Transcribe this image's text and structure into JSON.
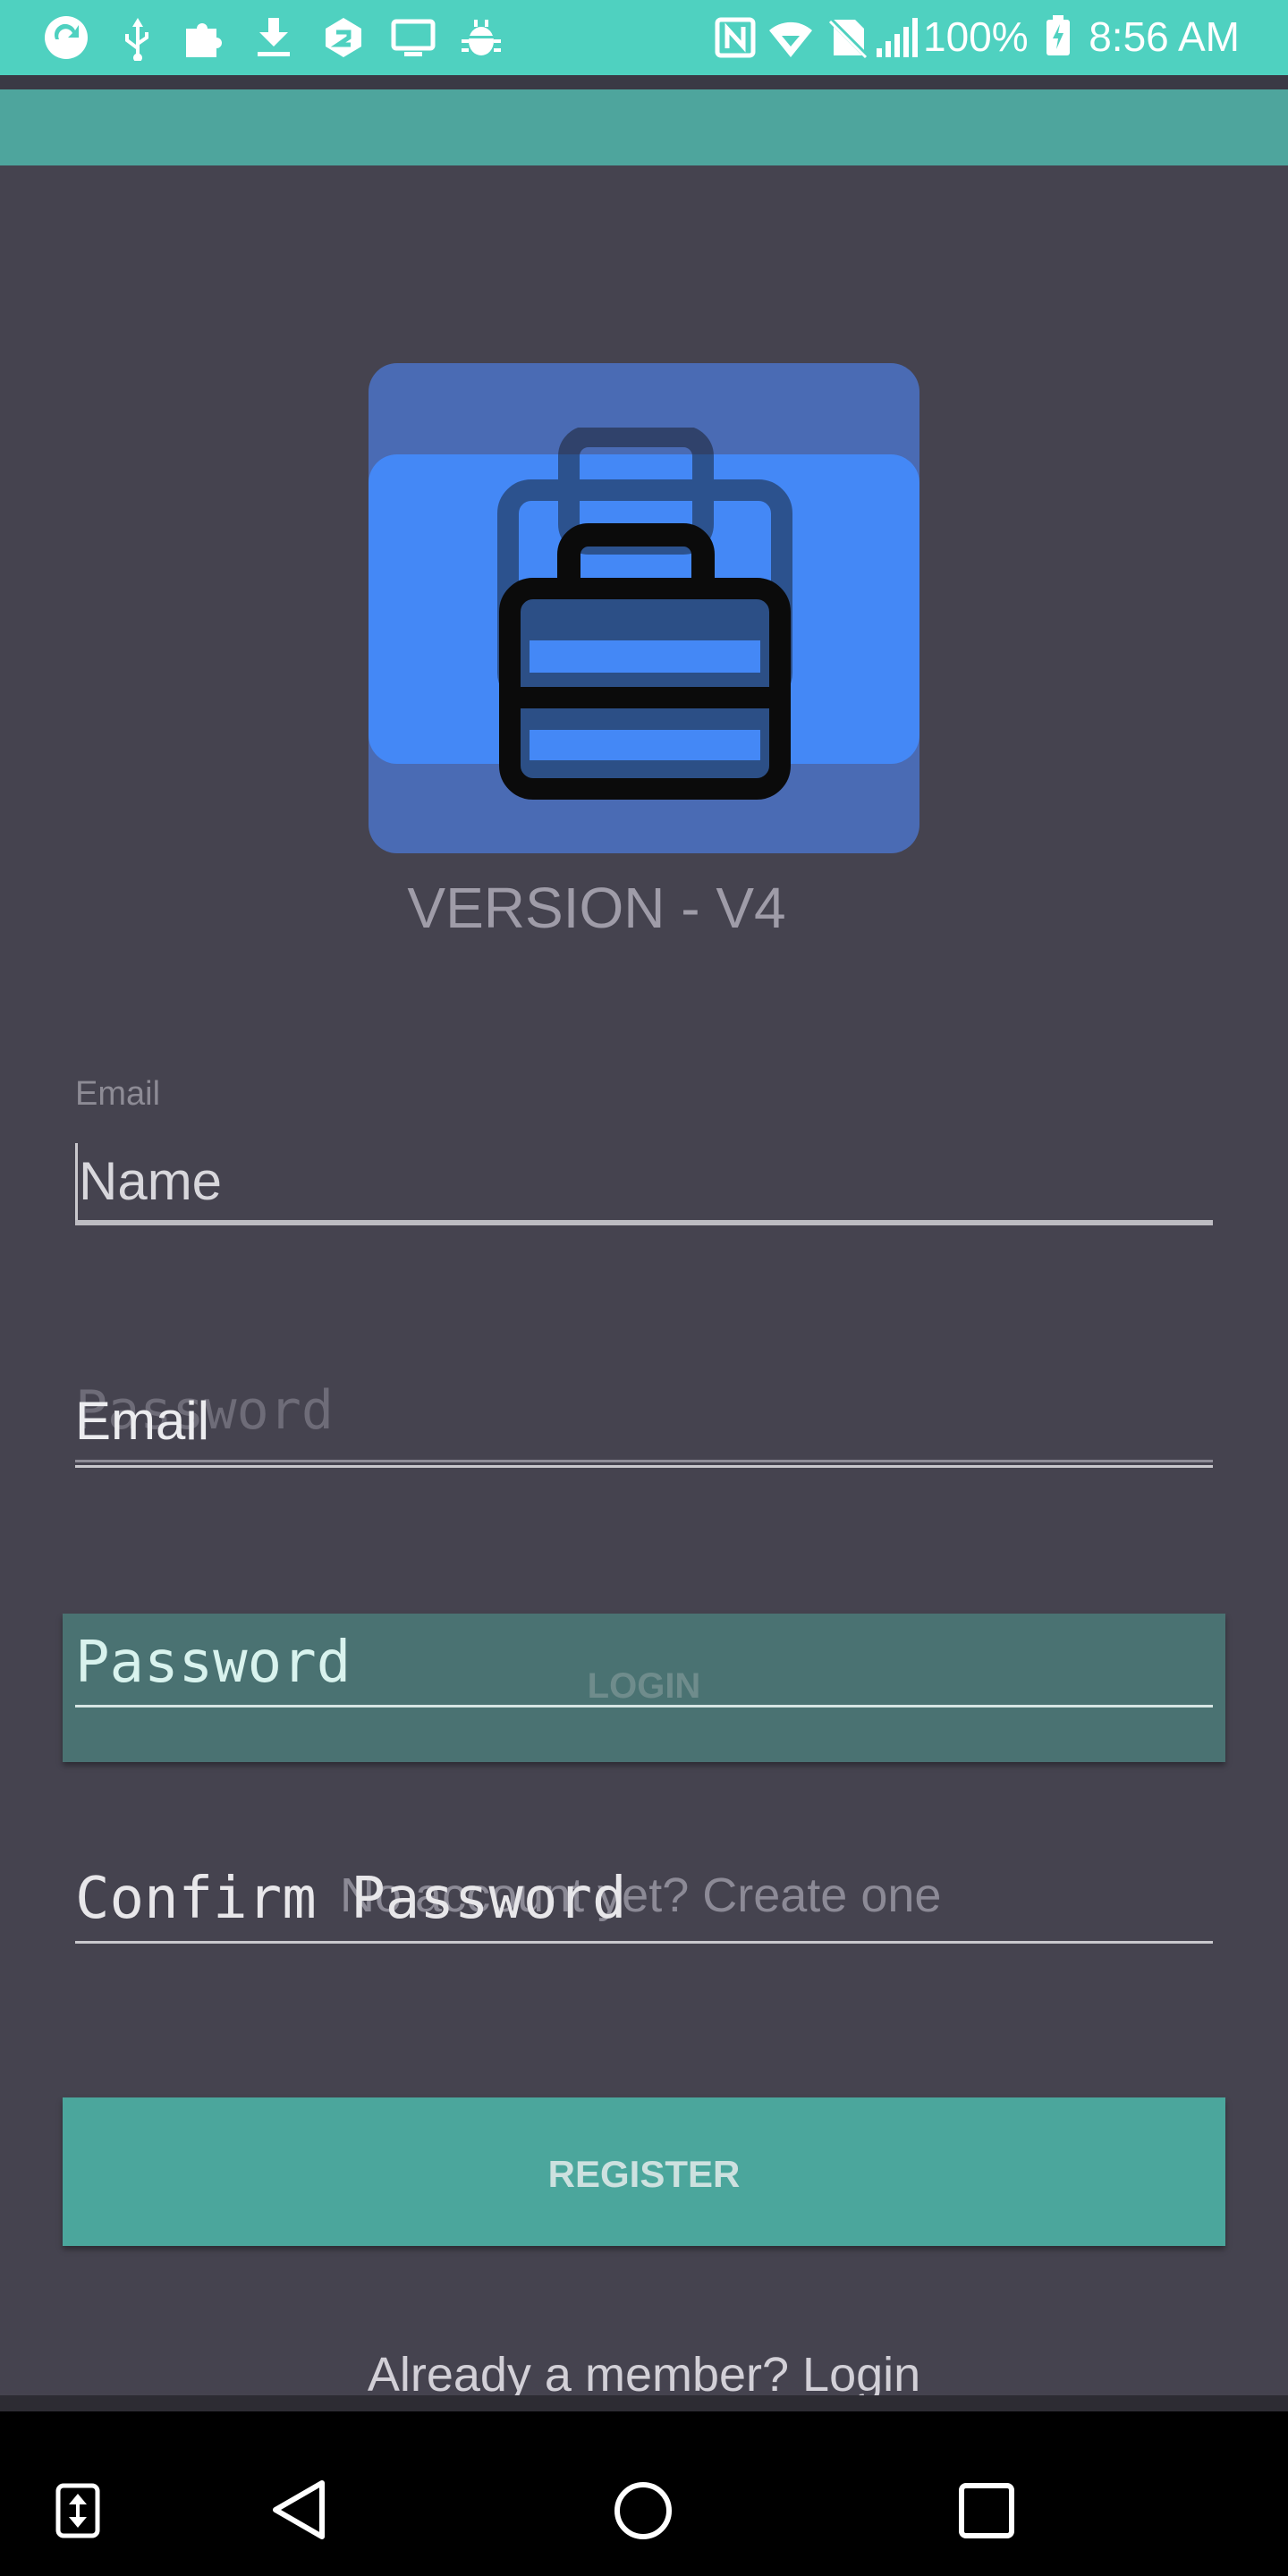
{
  "status_bar": {
    "battery": "100%",
    "time": "8:56 AM",
    "left_icons": [
      "app-sync-icon",
      "usb-icon",
      "puzzle-icon",
      "download-icon",
      "shield-app-icon",
      "monitor-icon",
      "android-bug-icon"
    ],
    "right_icons": [
      "nfc-icon",
      "wifi-icon",
      "no-sim-icon",
      "signal-icon",
      "battery-charging-icon"
    ]
  },
  "logo": {
    "icon": "briefcase-icon"
  },
  "version_label": "VERSION - V4",
  "login_form": {
    "email_floating_label": "Email",
    "password_placeholder": "Password",
    "login_button": "LOGIN",
    "create_account_link": "No account yet? Create one"
  },
  "register_form": {
    "name_placeholder": "Name",
    "email_placeholder": "Email",
    "password_placeholder": "Password",
    "confirm_password_placeholder": "Confirm Password",
    "register_button": "REGISTER",
    "login_link": "Already a member? Login"
  },
  "nav_bar": {
    "icons": [
      "swap-vertical-icon",
      "back-icon",
      "home-icon",
      "recents-icon"
    ]
  },
  "colors": {
    "status_bar": "#4fd1c0",
    "toolbar": "#4ea59d",
    "background": "#45434f",
    "login_button": "#4a7272",
    "register_button": "#4ba69c",
    "logo_blue": "#4488f6"
  }
}
